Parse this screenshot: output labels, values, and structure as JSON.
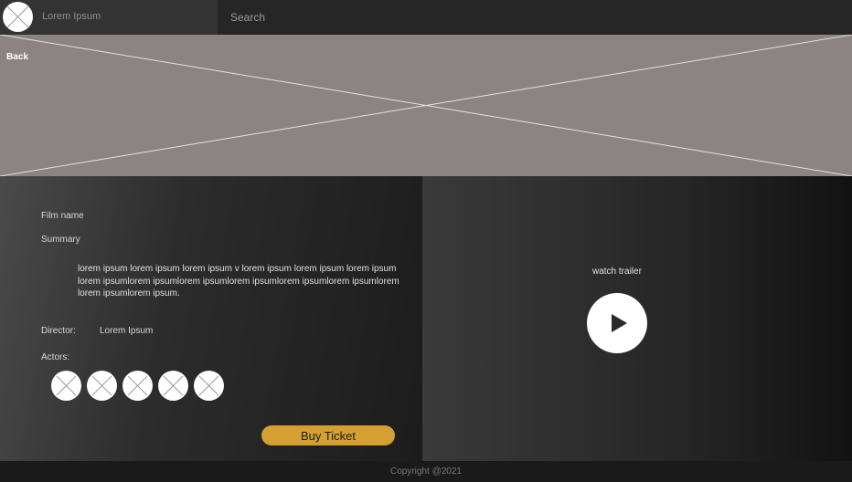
{
  "header": {
    "brand_name": "Lorem Ipsum",
    "search_placeholder": "Search"
  },
  "hero": {
    "back_label": "Back"
  },
  "details": {
    "film_name_label": "Film name",
    "summary_label": "Summary",
    "summary_text": "lorem ipsum lorem ipsum lorem ipsum v lorem ipsum lorem ipsum lorem ipsum lorem ipsumlorem ipsumlorem ipsumlorem ipsumlorem ipsumlorem ipsumlorem lorem ipsumlorem ipsum.",
    "director_label": "Director:",
    "director_value": "Lorem Ipsum",
    "actors_label": "Actors:",
    "actor_count": 5,
    "buy_label": "Buy Ticket"
  },
  "trailer": {
    "label": "watch trailer",
    "play_icon": "play-icon"
  },
  "footer": {
    "copyright": "Copyright @2021"
  },
  "colors": {
    "accent": "#d4a032",
    "hero_placeholder": "#8c8484",
    "topbar": "#262626",
    "brand_area": "#333333"
  }
}
